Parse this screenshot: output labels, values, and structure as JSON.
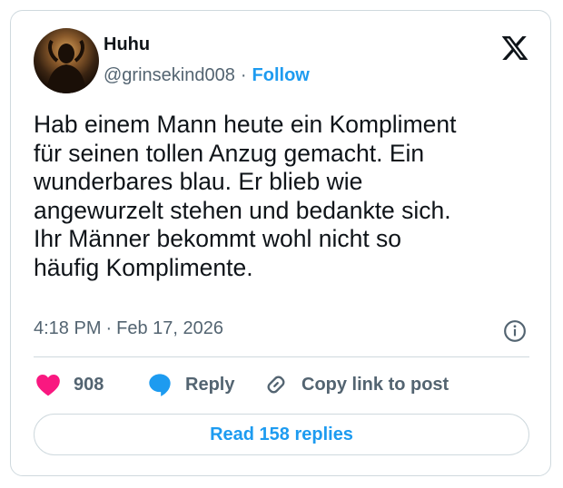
{
  "author": {
    "name": "Huhu",
    "handle": "@grinsekind008",
    "separator": "·",
    "follow_label": "Follow"
  },
  "tweet": {
    "text": "Hab einem Mann heute ein Kompliment\nfür seinen tollen Anzug gemacht. Ein\nwunderbares blau. Er blieb wie\nangewurzelt stehen und bedankte sich.\nIhr Männer bekommt wohl nicht so\nhäufig Komplimente.",
    "time": "4:18 PM",
    "separator": "·",
    "date": "Feb 17, 2026"
  },
  "actions": {
    "like_count": "908",
    "reply_label": "Reply",
    "copy_label": "Copy link to post"
  },
  "read_replies_label": "Read 158 replies",
  "icons": {
    "platform": "x-logo-icon",
    "info": "info-icon",
    "like": "heart-icon",
    "reply": "speech-bubble-icon",
    "copy": "link-icon"
  },
  "colors": {
    "accent": "#1d9bf0",
    "like": "#f91880",
    "text_primary": "#0f1419",
    "text_secondary": "#536471",
    "border": "#cfd9de"
  }
}
